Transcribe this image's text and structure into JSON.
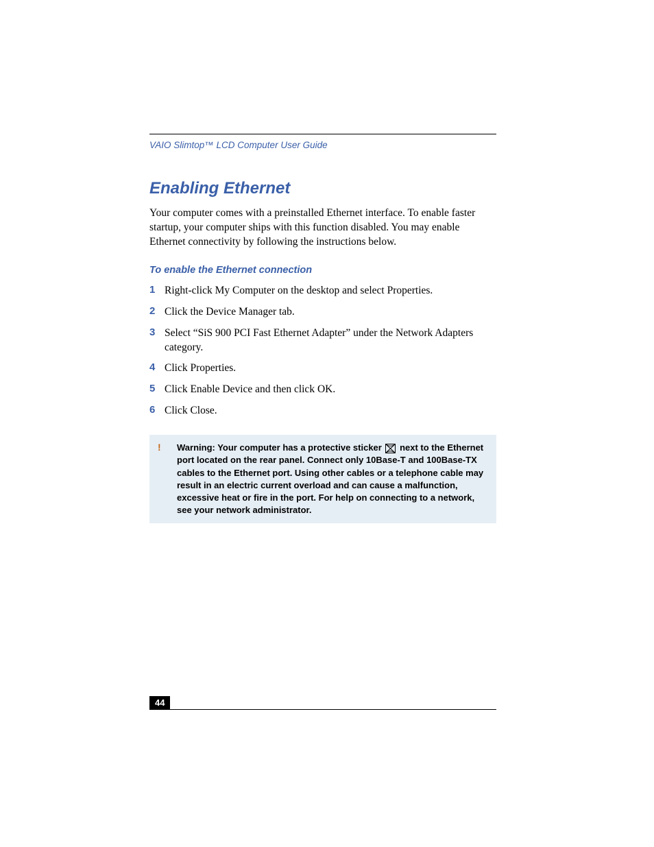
{
  "header": {
    "guide_title": "VAIO Slimtop™ LCD Computer User Guide"
  },
  "section": {
    "title": "Enabling Ethernet",
    "intro": "Your computer comes with a preinstalled Ethernet interface. To enable faster startup, your computer ships with this function disabled. You may enable Ethernet connectivity by following the instructions below."
  },
  "subsection": {
    "title": "To enable the Ethernet connection"
  },
  "steps": [
    {
      "num": "1",
      "text": "Right-click My Computer on the desktop and select Properties."
    },
    {
      "num": "2",
      "text": "Click the Device Manager tab."
    },
    {
      "num": "3",
      "text": "Select “SiS 900 PCI Fast Ethernet Adapter” under the Network Adapters category."
    },
    {
      "num": "4",
      "text": "Click Properties."
    },
    {
      "num": "5",
      "text": "Click Enable Device and then click OK."
    },
    {
      "num": "6",
      "text": "Click Close."
    }
  ],
  "warning": {
    "mark": "!",
    "text_before": "Warning: Your computer has a protective sticker ",
    "text_after": " next to the Ethernet port located on the rear panel. Connect only 10Base-T and 100Base-TX cables to the Ethernet port. Using other cables or a telephone cable may result in an electric current overload and can cause a malfunction, excessive heat or fire in the port. For help on connecting to a network, see your network administrator."
  },
  "footer": {
    "page_number": "44"
  }
}
